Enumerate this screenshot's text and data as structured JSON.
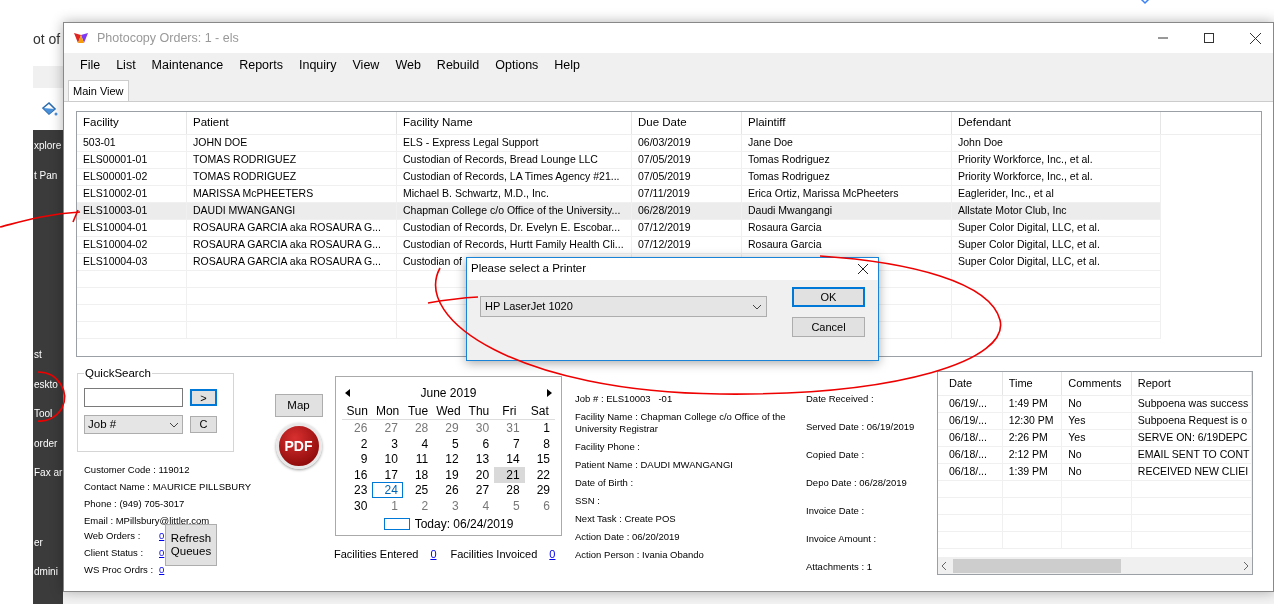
{
  "desktop": {
    "heading": "ot of",
    "sidebar_items": [
      "xplore",
      "t Pan",
      "st",
      "eskto",
      "Tool",
      "order",
      "Fax ar",
      "er",
      "dmini"
    ]
  },
  "window": {
    "title": "Photocopy Orders: 1 - els"
  },
  "menu": [
    "File",
    "List",
    "Maintenance",
    "Reports",
    "Inquiry",
    "View",
    "Web",
    "Rebuild",
    "Options",
    "Help"
  ],
  "tabs": [
    {
      "label": "Main View",
      "selected": true
    }
  ],
  "orders_table": {
    "columns": [
      "Facility",
      "Patient",
      "Facility Name",
      "Due Date",
      "Plaintiff",
      "Defendant"
    ],
    "rows": [
      {
        "selected": false,
        "cells": [
          "503-01",
          "JOHN DOE",
          "ELS - Express Legal Support",
          "06/03/2019",
          "Jane Doe",
          "John Doe"
        ]
      },
      {
        "selected": false,
        "cells": [
          "ELS00001-01",
          "TOMAS RODRIGUEZ",
          "Custodian of Records, Bread Lounge LLC",
          "07/05/2019",
          "Tomas Rodriguez",
          "Priority Workforce, Inc., et al."
        ]
      },
      {
        "selected": false,
        "cells": [
          "ELS00001-02",
          "TOMAS RODRIGUEZ",
          "Custodian of Records, LA Times Agency #21...",
          "07/05/2019",
          "Tomas Rodriguez",
          "Priority Workforce, Inc., et al."
        ]
      },
      {
        "selected": false,
        "cells": [
          "ELS10002-01",
          "MARISSA McPHEETERS",
          "Michael B. Schwartz, M.D., Inc.",
          "07/11/2019",
          "Erica Ortiz, Marissa McPheeters",
          "Eaglerider, Inc., et al"
        ]
      },
      {
        "selected": true,
        "cells": [
          "ELS10003-01",
          "DAUDI MWANGANGI",
          "Chapman College c/o Office of the University...",
          "06/28/2019",
          "Daudi Mwangangi",
          "Allstate Motor Club, Inc"
        ]
      },
      {
        "selected": false,
        "cells": [
          "ELS10004-01",
          "ROSAURA GARCIA aka ROSAURA G...",
          "Custodian of Records, Dr. Evelyn E. Escobar...",
          "07/12/2019",
          "Rosaura Garcia",
          "Super Color Digital, LLC, et al."
        ]
      },
      {
        "selected": false,
        "cells": [
          "ELS10004-02",
          "ROSAURA GARCIA aka ROSAURA G...",
          "Custodian of Records, Hurtt Family Health Cli...",
          "07/12/2019",
          "Rosaura Garcia",
          "Super Color Digital, LLC, et al."
        ]
      },
      {
        "selected": false,
        "cells": [
          "ELS10004-03",
          "ROSAURA GARCIA aka ROSAURA G...",
          "Custodian of",
          "",
          "",
          "Super Color Digital, LLC, et al."
        ]
      }
    ]
  },
  "dialog": {
    "title": "Please select a Printer",
    "printer": "HP LaserJet 1020",
    "buttons": [
      {
        "label": "OK",
        "default": true
      },
      {
        "label": "Cancel",
        "default": false
      }
    ]
  },
  "quick_search": {
    "title": "QuickSearch",
    "field": "Job #",
    "go": ">",
    "clear": "C"
  },
  "map_button": "Map",
  "pdf_label": "PDF",
  "customer": [
    "Customer Code : 119012",
    "Contact Name : MAURICE PILLSBURY",
    "Phone : (949) 705-3017",
    "Email : MPillsbury@littler.com"
  ],
  "queues": [
    {
      "label": "Web Orders :",
      "count": "0"
    },
    {
      "label": "Client Status :",
      "count": "0"
    },
    {
      "label": "WS Proc Ordrs :",
      "count": "0"
    }
  ],
  "refresh_button": "Refresh Queues",
  "calendar": {
    "month": "June 2019",
    "weekdays": [
      "Sun",
      "Mon",
      "Tue",
      "Wed",
      "Thu",
      "Fri",
      "Sat"
    ],
    "today_label": "Today: 06/24/2019",
    "weeks": [
      [
        {
          "d": "26",
          "other": true,
          "selected": false,
          "today": false
        },
        {
          "d": "27",
          "other": true,
          "selected": false,
          "today": false
        },
        {
          "d": "28",
          "other": true,
          "selected": false,
          "today": false
        },
        {
          "d": "29",
          "other": true,
          "selected": false,
          "today": false
        },
        {
          "d": "30",
          "other": true,
          "selected": false,
          "today": false
        },
        {
          "d": "31",
          "other": true,
          "selected": false,
          "today": false
        },
        {
          "d": "1",
          "other": false,
          "selected": false,
          "today": false
        }
      ],
      [
        {
          "d": "2",
          "other": false,
          "selected": false,
          "today": false
        },
        {
          "d": "3",
          "other": false,
          "selected": false,
          "today": false
        },
        {
          "d": "4",
          "other": false,
          "selected": false,
          "today": false
        },
        {
          "d": "5",
          "other": false,
          "selected": false,
          "today": false
        },
        {
          "d": "6",
          "other": false,
          "selected": false,
          "today": false
        },
        {
          "d": "7",
          "other": false,
          "selected": false,
          "today": false
        },
        {
          "d": "8",
          "other": false,
          "selected": false,
          "today": false
        }
      ],
      [
        {
          "d": "9",
          "other": false,
          "selected": false,
          "today": false
        },
        {
          "d": "10",
          "other": false,
          "selected": false,
          "today": false
        },
        {
          "d": "11",
          "other": false,
          "selected": false,
          "today": false
        },
        {
          "d": "12",
          "other": false,
          "selected": false,
          "today": false
        },
        {
          "d": "13",
          "other": false,
          "selected": false,
          "today": false
        },
        {
          "d": "14",
          "other": false,
          "selected": false,
          "today": false
        },
        {
          "d": "15",
          "other": false,
          "selected": false,
          "today": false
        }
      ],
      [
        {
          "d": "16",
          "other": false,
          "selected": false,
          "today": false
        },
        {
          "d": "17",
          "other": false,
          "selected": false,
          "today": false
        },
        {
          "d": "18",
          "other": false,
          "selected": false,
          "today": false
        },
        {
          "d": "19",
          "other": false,
          "selected": false,
          "today": false
        },
        {
          "d": "20",
          "other": false,
          "selected": false,
          "today": false
        },
        {
          "d": "21",
          "other": false,
          "selected": true,
          "today": false
        },
        {
          "d": "22",
          "other": false,
          "selected": false,
          "today": false
        }
      ],
      [
        {
          "d": "23",
          "other": false,
          "selected": false,
          "today": false
        },
        {
          "d": "24",
          "other": false,
          "selected": false,
          "today": true
        },
        {
          "d": "25",
          "other": false,
          "selected": false,
          "today": false
        },
        {
          "d": "26",
          "other": false,
          "selected": false,
          "today": false
        },
        {
          "d": "27",
          "other": false,
          "selected": false,
          "today": false
        },
        {
          "d": "28",
          "other": false,
          "selected": false,
          "today": false
        },
        {
          "d": "29",
          "other": false,
          "selected": false,
          "today": false
        }
      ],
      [
        {
          "d": "30",
          "other": false,
          "selected": false,
          "today": false
        },
        {
          "d": "1",
          "other": true,
          "selected": false,
          "today": false
        },
        {
          "d": "2",
          "other": true,
          "selected": false,
          "today": false
        },
        {
          "d": "3",
          "other": true,
          "selected": false,
          "today": false
        },
        {
          "d": "4",
          "other": true,
          "selected": false,
          "today": false
        },
        {
          "d": "5",
          "other": true,
          "selected": false,
          "today": false
        },
        {
          "d": "6",
          "other": true,
          "selected": false,
          "today": false
        }
      ]
    ]
  },
  "facilities": [
    {
      "label": "Facilities Entered",
      "count": "0"
    },
    {
      "label": "Facilities Invoiced",
      "count": "0"
    }
  ],
  "details_left": [
    "Job # : ELS10003   -01",
    "Facility Name : Chapman College c/o Office of the University Registrar",
    "Facility Phone :",
    "Patient Name : DAUDI MWANGANGI",
    "Date of Birth :",
    "SSN :",
    "Next Task : Create POS",
    "Action Date : 06/20/2019",
    "Action Person : Ivania Obando"
  ],
  "details_right": [
    "Date Received :",
    "Served Date : 06/19/2019",
    "Copied Date :",
    "Depo Date : 06/28/2019",
    "Invoice Date :",
    "Invoice Amount :",
    "Attachments : 1"
  ],
  "history_table": {
    "columns": [
      "Date",
      "Time",
      "Comments",
      "Report"
    ],
    "rows": [
      [
        "06/19/...",
        "1:49 PM",
        "No",
        "Subpoena was success"
      ],
      [
        "06/19/...",
        "12:30 PM",
        "Yes",
        "Subpoena Request is o"
      ],
      [
        "06/18/...",
        "2:26 PM",
        "Yes",
        "SERVE ON: 6/19DEPC"
      ],
      [
        "06/18/...",
        "2:12 PM",
        "No",
        "EMAIL SENT TO CONT"
      ],
      [
        "06/18/...",
        "1:39 PM",
        "No",
        "RECEIVED NEW CLIEI"
      ]
    ]
  }
}
